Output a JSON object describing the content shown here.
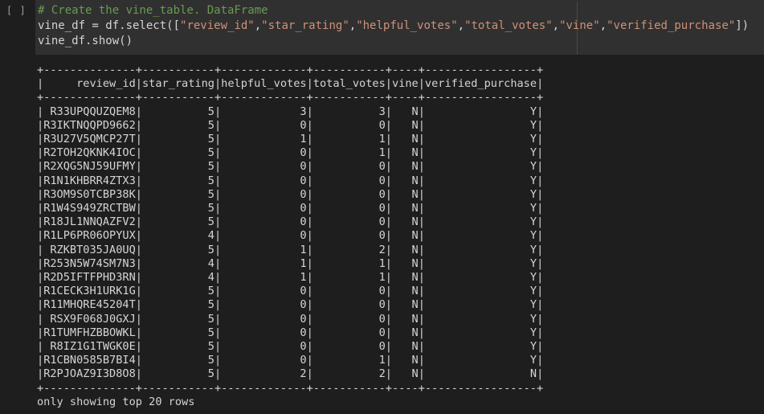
{
  "cell": {
    "run_marker": "[ ]",
    "code": {
      "comment": "# Create the vine_table. DataFrame",
      "line2_prefix": "vine_df = df.select([",
      "columns": [
        "\"review_id\"",
        "\"star_rating\"",
        "\"helpful_votes\"",
        "\"total_votes\"",
        "\"vine\"",
        "\"verified_purchase\""
      ],
      "line2_suffix": "])",
      "line3": "vine_df.show()"
    }
  },
  "output": {
    "headers": [
      "review_id",
      "star_rating",
      "helpful_votes",
      "total_votes",
      "vine",
      "verified_purchase"
    ],
    "rows": [
      [
        "R33UPQQUZQEM8",
        "5",
        "3",
        "3",
        "N",
        "Y"
      ],
      [
        "R3IKTNQQPD9662",
        "5",
        "0",
        "0",
        "N",
        "Y"
      ],
      [
        "R3U27V5QMCP27T",
        "5",
        "1",
        "1",
        "N",
        "Y"
      ],
      [
        "R2TOH2QKNK4IOC",
        "5",
        "0",
        "1",
        "N",
        "Y"
      ],
      [
        "R2XQG5NJ59UFMY",
        "5",
        "0",
        "0",
        "N",
        "Y"
      ],
      [
        "R1N1KHBRR4ZTX3",
        "5",
        "0",
        "0",
        "N",
        "Y"
      ],
      [
        "R3OM9S0TCBP38K",
        "5",
        "0",
        "0",
        "N",
        "Y"
      ],
      [
        "R1W4S949ZRCTBW",
        "5",
        "0",
        "0",
        "N",
        "Y"
      ],
      [
        "R18JL1NNQAZFV2",
        "5",
        "0",
        "0",
        "N",
        "Y"
      ],
      [
        "R1LP6PR06OPYUX",
        "4",
        "0",
        "0",
        "N",
        "Y"
      ],
      [
        "RZKBT035JA0UQ",
        "5",
        "1",
        "2",
        "N",
        "Y"
      ],
      [
        "R253N5W74SM7N3",
        "4",
        "1",
        "1",
        "N",
        "Y"
      ],
      [
        "R2D5IFTFPHD3RN",
        "4",
        "1",
        "1",
        "N",
        "Y"
      ],
      [
        "R1CECK3H1URK1G",
        "5",
        "0",
        "0",
        "N",
        "Y"
      ],
      [
        "R11MHQRE45204T",
        "5",
        "0",
        "0",
        "N",
        "Y"
      ],
      [
        "RSX9F068J0GXJ",
        "5",
        "0",
        "0",
        "N",
        "Y"
      ],
      [
        "R1TUMFHZBBOWKL",
        "5",
        "0",
        "0",
        "N",
        "Y"
      ],
      [
        "R8IZ1G1TWGK0E",
        "5",
        "0",
        "0",
        "N",
        "Y"
      ],
      [
        "R1CBN0585B7BI4",
        "5",
        "0",
        "1",
        "N",
        "Y"
      ],
      [
        "R2PJOAZ9I3D8O8",
        "5",
        "2",
        "2",
        "N",
        "N"
      ]
    ],
    "footer": "only showing top 20 rows"
  }
}
